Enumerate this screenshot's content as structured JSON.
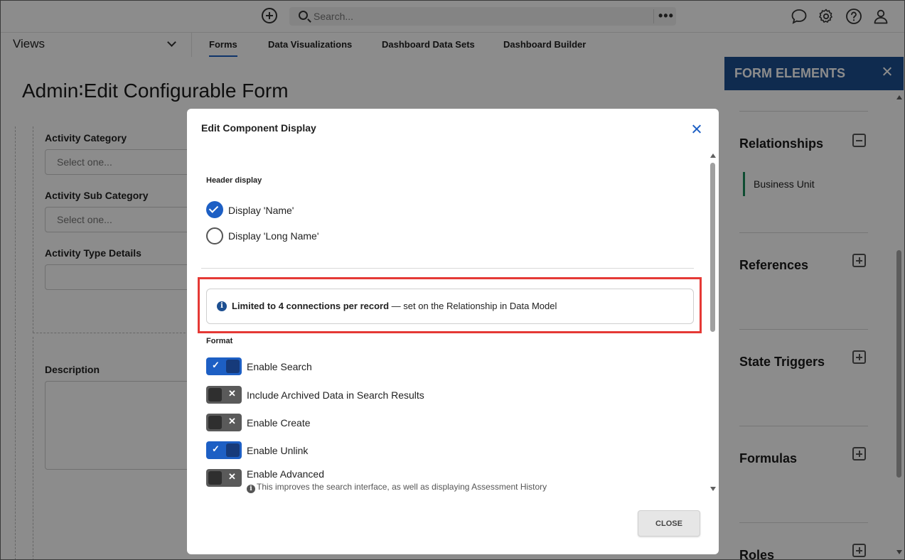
{
  "topbar": {
    "search_placeholder": "Search...",
    "more_label": "•••"
  },
  "nav": {
    "views_label": "Views",
    "tabs": [
      {
        "label": "Forms",
        "active": true
      },
      {
        "label": "Data Visualizations",
        "active": false
      },
      {
        "label": "Dashboard Data Sets",
        "active": false
      },
      {
        "label": "Dashboard Builder",
        "active": false
      }
    ]
  },
  "page": {
    "title": "Admin∶Edit Configurable Form",
    "fields": [
      {
        "label": "Activity Category",
        "placeholder": "Select one..."
      },
      {
        "label": "Activity Sub Category",
        "placeholder": "Select one..."
      },
      {
        "label": "Activity Type Details",
        "placeholder": ""
      },
      {
        "label": "Description",
        "placeholder": ""
      }
    ]
  },
  "panel": {
    "title": "FORM ELEMENTS",
    "sections": [
      {
        "label": "Relationships",
        "expanded": true,
        "items": [
          "Business Unit"
        ]
      },
      {
        "label": "References",
        "expanded": false
      },
      {
        "label": "State Triggers",
        "expanded": false
      },
      {
        "label": "Formulas",
        "expanded": false
      },
      {
        "label": "Roles",
        "expanded": false
      }
    ]
  },
  "modal": {
    "title": "Edit Component Display",
    "header_display_label": "Header display",
    "radios": [
      {
        "label": "Display 'Name'",
        "checked": true
      },
      {
        "label": "Display 'Long Name'",
        "checked": false
      }
    ],
    "info": {
      "bold": "Limited to 4 connections per record",
      "rest": " — set on the Relationship in Data Model"
    },
    "format_label": "Format",
    "toggles": [
      {
        "label": "Enable Search",
        "on": true
      },
      {
        "label": "Include Archived Data in Search Results",
        "on": false
      },
      {
        "label": "Enable Create",
        "on": false
      },
      {
        "label": "Enable Unlink",
        "on": true
      },
      {
        "label": "Enable Advanced",
        "on": false
      }
    ],
    "advanced_hint": "This improves the search interface, as well as displaying Assessment History",
    "close_label": "CLOSE"
  },
  "colors": {
    "accent": "#1d5fc4",
    "panel_header": "#1d4f91",
    "highlight": "#e53935"
  },
  "icons": [
    "add-circle-icon",
    "search-icon",
    "more-icon",
    "chat-icon",
    "gear-icon",
    "help-icon",
    "user-icon",
    "chevron-down-icon",
    "close-icon",
    "info-icon",
    "check-icon"
  ]
}
